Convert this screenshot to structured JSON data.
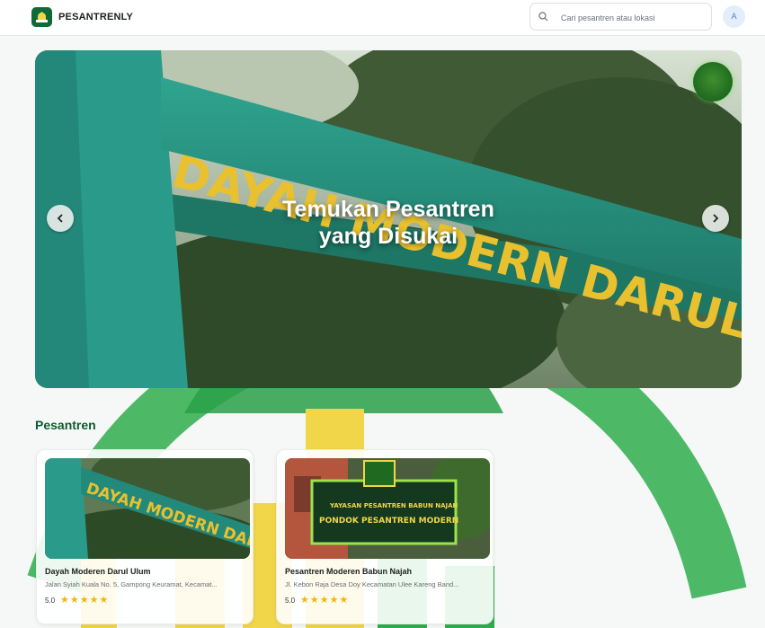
{
  "header": {
    "brand": "PESANTRENLY",
    "search_placeholder": "Cari pesantren atau lokasi",
    "avatar_initial": "A"
  },
  "hero": {
    "title_line1": "Temukan Pesantren",
    "title_line2": "yang Disukai",
    "sign_text": "DAYAH MODERN DARUL 'ULUM"
  },
  "section": {
    "title": "Pesantren"
  },
  "cards": [
    {
      "name": "Dayah Moderen Darul Ulum",
      "address": "Jalan Syiah Kuala No. 5, Gampong Keuramat, Kecamat...",
      "rating": "5.0",
      "stars": "★★★★★"
    },
    {
      "name": "Pesantren Moderen Babun Najah",
      "address": "Jl. Kebon Raja Desa Doy Kecamatan Ulee Kareng Band...",
      "rating": "5.0",
      "stars": "★★★★★"
    }
  ],
  "colors": {
    "brand_green": "#0f6a38",
    "section_title": "#0d5b2f",
    "star": "#f2b705",
    "watermark_green": "#27a34a",
    "watermark_yellow": "#f3d84a"
  }
}
